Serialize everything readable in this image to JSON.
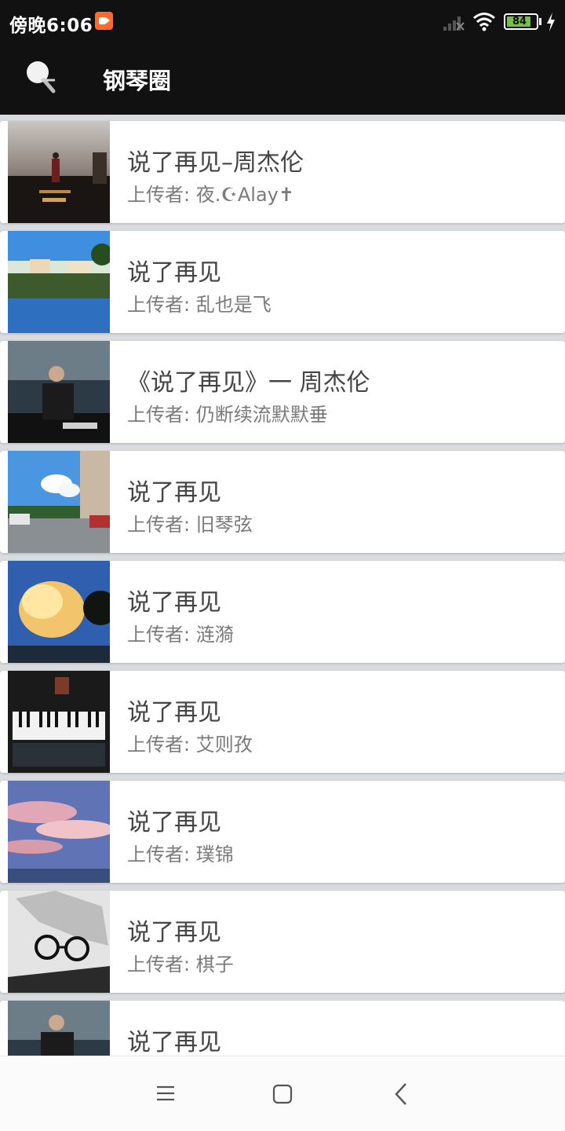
{
  "status_bar": {
    "time": "傍晚6:06",
    "battery": "84",
    "icons": [
      "recording-icon",
      "signal-icon",
      "wifi-icon",
      "battery-icon",
      "charging-icon"
    ]
  },
  "app_bar": {
    "title": "钢琴圈",
    "search_icon": "search-icon"
  },
  "uploader_prefix": "上传者: ",
  "items": [
    {
      "title": "说了再见–周杰伦",
      "uploader": "上传者: 夜.☪Alay✝"
    },
    {
      "title": "说了再见",
      "uploader": "上传者: 乱也是飞"
    },
    {
      "title": "《说了再见》一 周杰伦",
      "uploader": "上传者: 仍断续流默默垂"
    },
    {
      "title": "说了再见",
      "uploader": "上传者: 旧琴弦"
    },
    {
      "title": "说了再见",
      "uploader": "上传者: 涟漪"
    },
    {
      "title": "说了再见",
      "uploader": "上传者: 艾则孜"
    },
    {
      "title": "说了再见",
      "uploader": "上传者: 璞锦"
    },
    {
      "title": "说了再见",
      "uploader": "上传者: 棋子"
    },
    {
      "title": "说了再见",
      "uploader": ""
    }
  ],
  "nav_bar": {
    "icons": [
      "menu-icon",
      "home-square-icon",
      "back-icon"
    ]
  }
}
